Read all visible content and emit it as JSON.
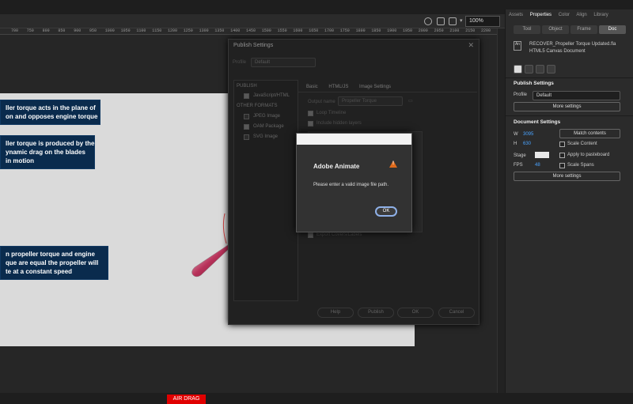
{
  "toolbar": {
    "zoom": "100%"
  },
  "ruler": {
    "ticks": [
      "700",
      "750",
      "800",
      "850",
      "900",
      "950",
      "1000",
      "1050",
      "1100",
      "1150",
      "1200",
      "1250",
      "1300",
      "1350",
      "1400",
      "1450",
      "1500",
      "1550",
      "1600",
      "1650",
      "1700",
      "1750",
      "1800",
      "1850",
      "1900",
      "1950",
      "2000",
      "2050",
      "2100",
      "2150",
      "2200",
      "2250",
      "2300"
    ]
  },
  "stage": {
    "info_boxes": [
      "ller torque acts in the plane of\non and opposes engine torque",
      "ller torque is produced by the\nynamic drag on the blades\nin motion",
      "n propeller torque and engine\nque are equal the propeller will\nte at a constant speed"
    ],
    "air_drag_label": "AIR DRAG"
  },
  "right_panel": {
    "tabs": [
      "Assets",
      "Properties",
      "Color",
      "Align",
      "Library"
    ],
    "subtabs": [
      "Tool",
      "Object",
      "Frame",
      "Doc"
    ],
    "doc_title": "RECOVER_Propeller Torque Updated.fla",
    "doc_type": "HTML5 Canvas Document",
    "doc_icon": "An",
    "publish_settings_heading": "Publish Settings",
    "profile_label": "Profile",
    "profile_value": "Default",
    "more_settings": "More settings",
    "document_settings_heading": "Document Settings",
    "w_label": "W",
    "w_value": "3095",
    "h_label": "H",
    "h_value": "630",
    "match_contents": "Match contents",
    "scale_content": "Scale Content",
    "stage_label": "Stage",
    "apply_pasteboard": "Apply to pasteboard",
    "fps_label": "FPS",
    "fps_value": "48",
    "scale_spans": "Scale Spans",
    "more_settings_2": "More settings"
  },
  "publish_dialog": {
    "title": "Publish Settings",
    "profile_label": "Profile",
    "profile_value": "Default",
    "publish_heading": "PUBLISH",
    "javascript_html": "JavaScript/HTML",
    "other_formats": "OTHER FORMATS",
    "jpeg": "JPEG Image",
    "oam": "OAM Package",
    "svg": "SVG Image",
    "right_tabs": [
      "Basic",
      "HTML/JS",
      "Image Settings"
    ],
    "output_name_label": "Output name",
    "output_name_value": "Propeller Torque",
    "loop_timeline": "Loop Timeline",
    "include_hidden": "Include hidden layers",
    "export_covers": "Export Covers/Labels",
    "buttons": {
      "help": "Help",
      "publish": "Publish",
      "ok": "OK",
      "cancel": "Cancel"
    }
  },
  "alert": {
    "title": "Adobe Animate",
    "message": "Please enter a valid image file path.",
    "ok": "OK"
  },
  "colors": {
    "stage_bg": "#dadada",
    "info_box": "#0a2b4d",
    "air_drag": "#e00000",
    "accent": "#4aa3ff",
    "warning": "#e06a1b"
  }
}
